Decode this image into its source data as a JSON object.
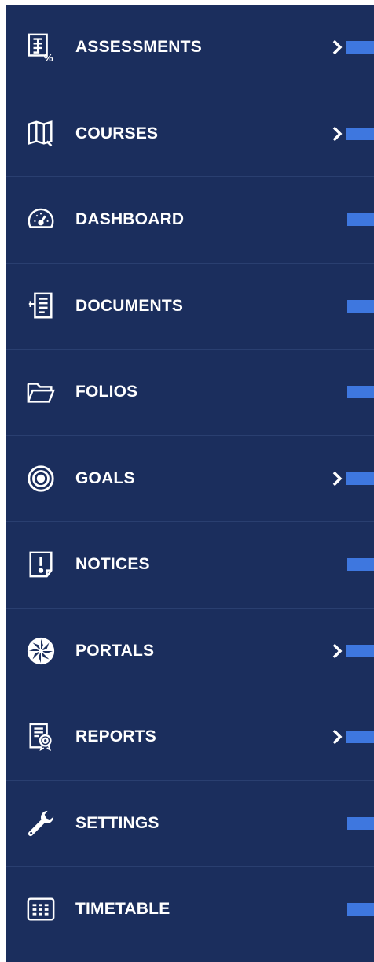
{
  "menu": {
    "items": [
      {
        "label": "ASSESSMENTS",
        "icon": "assessment-grid-icon",
        "has_submenu": true
      },
      {
        "label": "COURSES",
        "icon": "book-icon",
        "has_submenu": true
      },
      {
        "label": "DASHBOARD",
        "icon": "speedometer-icon",
        "has_submenu": false
      },
      {
        "label": "DOCUMENTS",
        "icon": "document-icon",
        "has_submenu": false
      },
      {
        "label": "FOLIOS",
        "icon": "folder-icon",
        "has_submenu": false
      },
      {
        "label": "GOALS",
        "icon": "target-icon",
        "has_submenu": true
      },
      {
        "label": "NOTICES",
        "icon": "notice-icon",
        "has_submenu": false
      },
      {
        "label": "PORTALS",
        "icon": "portal-icon",
        "has_submenu": true
      },
      {
        "label": "REPORTS",
        "icon": "report-icon",
        "has_submenu": true
      },
      {
        "label": "SETTINGS",
        "icon": "wrench-icon",
        "has_submenu": false
      },
      {
        "label": "TIMETABLE",
        "icon": "timetable-icon",
        "has_submenu": false
      }
    ]
  },
  "colors": {
    "background": "#1b2e5d",
    "text": "#ffffff",
    "accent": "#3e77df"
  }
}
